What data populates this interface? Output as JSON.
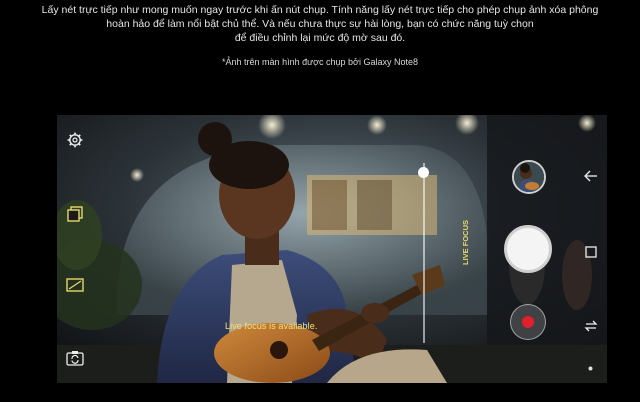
{
  "caption": {
    "lines": [
      "Lấy nét trực tiếp như mong muốn ngay trước khi ấn nút chụp. Tính năng lấy nét trực tiếp cho phép chụp ảnh xóa phông",
      "hoàn hảo để làm nổi bật chủ thể. Và nếu chưa thực sự hài lòng, bạn có chức năng tuỳ chọn",
      "để điều chỉnh lại mức độ mờ sau đó."
    ],
    "note": "*Ảnh trên màn hình được chụp bởi Galaxy Note8"
  },
  "camera": {
    "message": "Live focus is available.",
    "live_focus_label": "LIVE FOCUS",
    "blur_level": 0.95
  },
  "colors": {
    "accent_yellow": "#e7d86c",
    "record_red": "#e0212b"
  },
  "icons": {
    "settings": "gear-icon",
    "back": "arrow-left-icon",
    "layers": "stacked-squares-icon",
    "aspect": "aspect-ratio-icon",
    "switch_camera": "switch-camera-icon",
    "square": "square-icon",
    "mode_switch": "swap-icon"
  }
}
